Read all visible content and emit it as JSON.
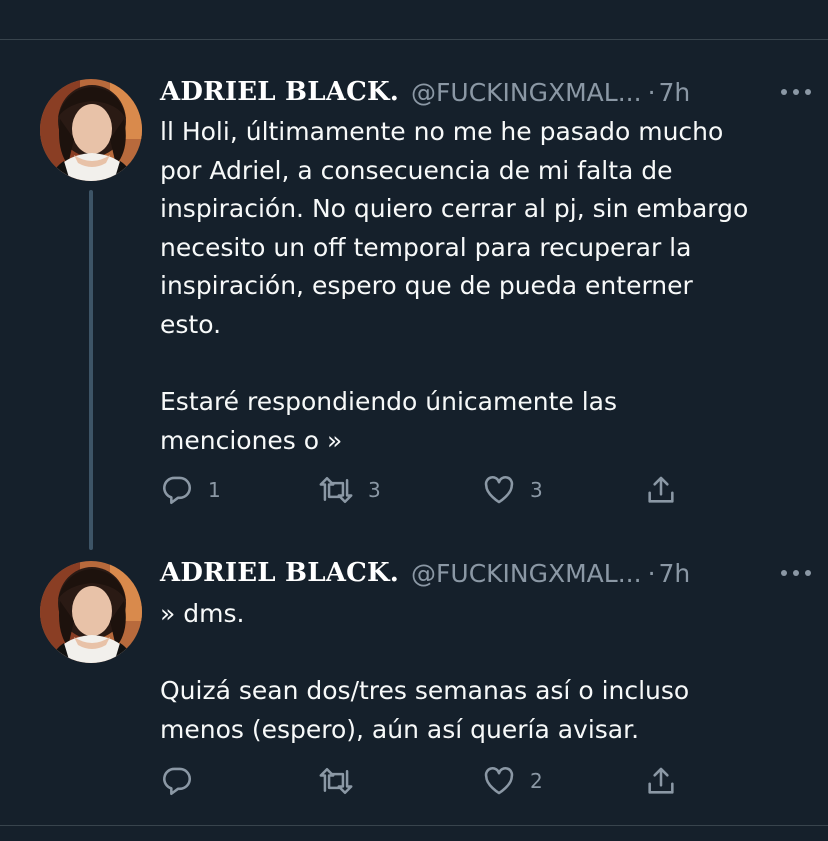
{
  "tweets": [
    {
      "author_name": "ADRIEL BLACK.",
      "handle": "@FUCKINGXMAL...",
      "separator": "·",
      "time": "7h",
      "text": "ll Holi, últimamente no me he pasado mucho\npor Adriel, a consecuencia de mi falta de\ninspiración. No quiero cerrar al pj, sin embargo\nnecesito un off temporal para recuperar la\ninspiración, espero que de pueda enterner\nesto.\n\nEstaré respondiendo únicamente las\nmenciones o »",
      "reply_count": "1",
      "retweet_count": "3",
      "like_count": "3",
      "icons": [
        "more-icon",
        "reply-icon",
        "retweet-icon",
        "like-icon",
        "share-icon"
      ]
    },
    {
      "author_name": "ADRIEL BLACK.",
      "handle": "@FUCKINGXMAL...",
      "separator": "·",
      "time": "7h",
      "text": "» dms.\n\nQuizá sean dos/tres semanas así o incluso\nmenos (espero), aún así quería avisar.",
      "reply_count": "",
      "retweet_count": "",
      "like_count": "2",
      "icons": [
        "more-icon",
        "reply-icon",
        "retweet-icon",
        "like-icon",
        "share-icon"
      ]
    }
  ],
  "colors": {
    "background": "#15202b",
    "divider": "#38444d",
    "thread_line": "#3d5466",
    "secondary_text": "#8b98a5",
    "primary_text": "#f7f9f9"
  }
}
